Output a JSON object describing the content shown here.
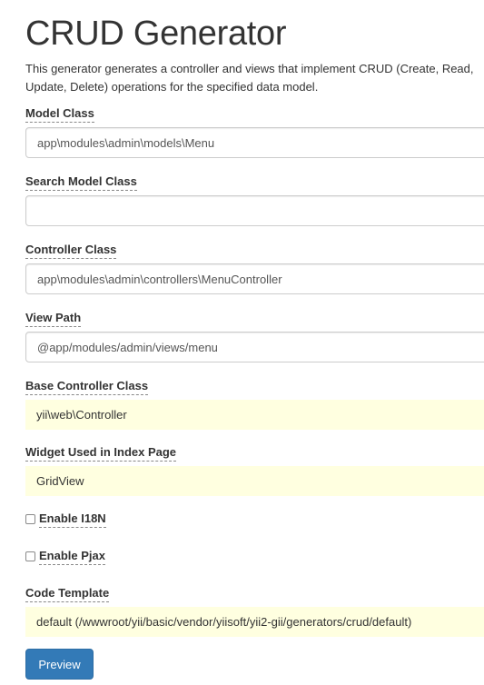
{
  "page": {
    "title": "CRUD Generator",
    "description": "This generator generates a controller and views that implement CRUD (Create, Read, Update, Delete) operations for the specified data model."
  },
  "fields": {
    "model_class": {
      "label": "Model Class",
      "value": "app\\modules\\admin\\models\\Menu"
    },
    "search_model_class": {
      "label": "Search Model Class",
      "value": ""
    },
    "controller_class": {
      "label": "Controller Class",
      "value": "app\\modules\\admin\\controllers\\MenuController"
    },
    "view_path": {
      "label": "View Path",
      "value": "@app/modules/admin/views/menu"
    },
    "base_controller_class": {
      "label": "Base Controller Class",
      "value": "yii\\web\\Controller"
    },
    "index_widget": {
      "label": "Widget Used in Index Page",
      "value": "GridView"
    },
    "enable_i18n": {
      "label": "Enable I18N",
      "checked": false
    },
    "enable_pjax": {
      "label": "Enable Pjax",
      "checked": false
    },
    "code_template": {
      "label": "Code Template",
      "value": "default (/wwwroot/yii/basic/vendor/yiisoft/yii2-gii/generators/crud/default)"
    }
  },
  "actions": {
    "preview_label": "Preview"
  },
  "colors": {
    "sticky_background": "#ffffe0",
    "primary_button": "#337ab7"
  }
}
